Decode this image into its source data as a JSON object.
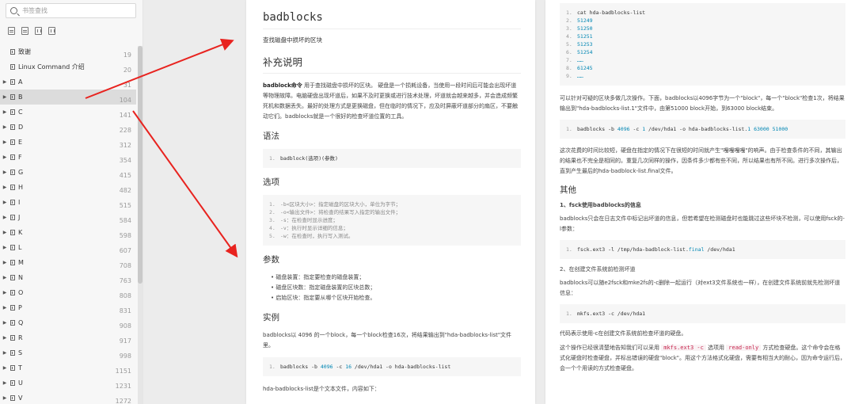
{
  "sidebar": {
    "search_placeholder": "书签查找",
    "items": [
      {
        "label": "致谢",
        "page": "19",
        "caret": ""
      },
      {
        "label": "Linux Command 介绍",
        "page": "20",
        "caret": ""
      },
      {
        "label": "A",
        "page": "31",
        "caret": "▶"
      },
      {
        "label": "B",
        "page": "104",
        "caret": "▶",
        "active": true
      },
      {
        "label": "C",
        "page": "141",
        "caret": "▶"
      },
      {
        "label": "D",
        "page": "228",
        "caret": "▶"
      },
      {
        "label": "E",
        "page": "312",
        "caret": "▶"
      },
      {
        "label": "F",
        "page": "354",
        "caret": "▶"
      },
      {
        "label": "G",
        "page": "415",
        "caret": "▶"
      },
      {
        "label": "H",
        "page": "482",
        "caret": "▶"
      },
      {
        "label": "I",
        "page": "515",
        "caret": "▶"
      },
      {
        "label": "J",
        "page": "584",
        "caret": "▶"
      },
      {
        "label": "K",
        "page": "598",
        "caret": "▶"
      },
      {
        "label": "L",
        "page": "607",
        "caret": "▶"
      },
      {
        "label": "M",
        "page": "708",
        "caret": "▶"
      },
      {
        "label": "N",
        "page": "763",
        "caret": "▶"
      },
      {
        "label": "O",
        "page": "808",
        "caret": "▶"
      },
      {
        "label": "P",
        "page": "831",
        "caret": "▶"
      },
      {
        "label": "Q",
        "page": "908",
        "caret": "▶"
      },
      {
        "label": "R",
        "page": "917",
        "caret": "▶"
      },
      {
        "label": "S",
        "page": "998",
        "caret": "▶"
      },
      {
        "label": "T",
        "page": "1151",
        "caret": "▶"
      },
      {
        "label": "U",
        "page": "1231",
        "caret": "▶"
      },
      {
        "label": "V",
        "page": "1272",
        "caret": "▶"
      }
    ]
  },
  "left_page": {
    "title": "badblocks",
    "subtitle": "查找磁盘中损坏的区块",
    "h_supp": "补充说明",
    "supp_lead": "badblock命令",
    "supp_text": " 用于查找磁盘中损坏的区块。 硬盘是一个损耗设备，当使用一段时间后可能会出现坏道等物理故障。电脑硬盘出现坏道后，如果不及时更换或进行技术处理，坏道就会越来越多，并会造成频繁死机和数据丢失。最好的处理方式是更换磁盘，但在临时的情况下，应及时屏蔽坏道部分的扇区，不要触动它们。badblocks就是一个很好的检查坏道位置的工具。",
    "h_syntax": "语法",
    "syntax_code": "badblock(选项)(参数)",
    "h_options": "选项",
    "options": [
      "-b<区块大小>：指定磁盘的区块大小，单位为字节；",
      "-o<输出文件>：将检查的结果写入指定的输出文件；",
      "-s：在检查时显示进度；",
      "-v：执行时显示详细的信息；",
      "-w：在检查时，执行写入测试。"
    ],
    "h_params": "参数",
    "params": [
      "磁盘装置：指定要检查的磁盘装置；",
      "磁盘区块数：指定磁盘装置的区块总数；",
      "启始区块：指定要从哪个区块开始检查。"
    ],
    "h_example": "实例",
    "example_text": "badblocks以 4096 的一个block，每一个block检查16次，将结果输出到\"hda-badblocks-list\"文件里。",
    "example_code": {
      "a": "badblocks -b ",
      "n1": "4096",
      "b": " -c ",
      "n2": "16",
      "c": " /dev/hda1 -o hda-badblocks-list"
    },
    "tail_text": "hda-badblocks-list是个文本文件，内容如下："
  },
  "right_page": {
    "list_code": [
      "cat hda-badblocks-list",
      "51249",
      "51250",
      "51251",
      "51253",
      "51254",
      "……",
      "61245",
      "……"
    ],
    "p1": "可以针对可疑的区块多做几次操作。下面，badblocks以4096字节为一个\"block\"，每一个\"block\"检查1次，将结果输出到\"hda-badblocks-list.1\"文件中，由第51000 block开始，到63000 block结束。",
    "code2": {
      "a": "badblocks -b ",
      "n1": "4096",
      "b": " -c ",
      "n2": "1",
      "c": " /dev/hda1 -o hda-badblocks-list.",
      "n3": "1",
      "d": " ",
      "n4": "63000",
      "e": " ",
      "n5": "51000"
    },
    "p2": "这次花费的时间比较短，硬盘在指定的情况下在很短的时间就产生\"嘎嘎嘎嘎\"的响声。由于检查条件的不同，其输出的结果也不完全是相同的。重复几次同样的操作，因条件多少都有些不同，所以结果也有所不同。进行多次操作后，直到产生最后的hda-badblock-list.final文件。",
    "h_other": "其他",
    "s1_title": "1、fsck使用badblocks的信息",
    "p3": "badblocks只会在日志文件中标记出坏道的信息，但若希望在检测磁盘时也能跳过这些坏块不检测，可以使用fsck的-l参数：",
    "code3": {
      "a": "fsck.ext3 -l /tmp/hda-badblock-list.",
      "kw": "final",
      "b": " /dev/hda1"
    },
    "s2_title": "2、在创建文件系统前检测坏道",
    "p4": "badblocks可以随e2fsck和mke2fs的-c删除一起运行（对ext3文件系统也一样），在创建文件系统前就先检测坏道信息：",
    "code4": "mkfs.ext3 -c /dev/hda1",
    "p5": "代码表示使用-c在创建文件系统前检查坏道的硬盘。",
    "p6a": "这个操作已经很清楚地告知我们可以采用 ",
    "p6b": "mkfs.ext3 -c",
    "p6c": " 选项用 ",
    "p6d": "read-only",
    "p6e": " 方式检查硬盘。这个命令会在格式化硬盘时检查硬盘，并标出错误的硬盘\"block\"。用这个方法格式化硬盘，需要有相当大的耐心，因为命令运行后，会一个个用读的方式检查硬盘。"
  },
  "colors": {
    "arrow": "#e8231f"
  }
}
